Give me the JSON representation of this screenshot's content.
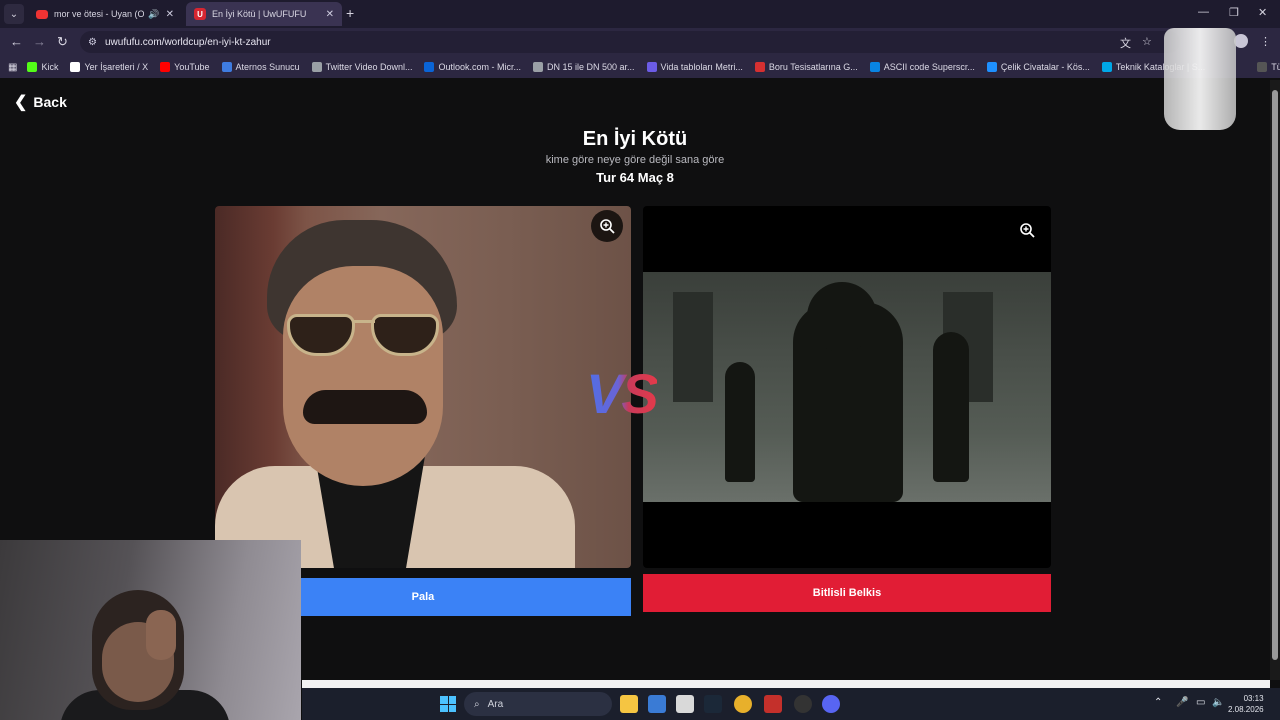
{
  "browser": {
    "tabs": [
      {
        "title": "mor ve ötesi - Uyan (Officia",
        "icon": "youtube-icon",
        "audio": true
      },
      {
        "title": "En İyi Kötü | UwUFUFU",
        "icon": "uwufufu-icon",
        "active": true
      }
    ],
    "url": "uwufufu.com/worldcup/en-iyi-kt-zahur",
    "bookmarks": [
      {
        "label": "Kick",
        "color": "#53fc18"
      },
      {
        "label": "Yer İşaretleri / X",
        "color": "#ffffff"
      },
      {
        "label": "YouTube",
        "color": "#ff0000"
      },
      {
        "label": "Aternos Sunucu",
        "color": "#3f7ce0"
      },
      {
        "label": "Twitter Video Downl...",
        "color": "#9aa0a6"
      },
      {
        "label": "Outlook.com - Micr...",
        "color": "#0a64d6"
      },
      {
        "label": "DN 15 ile DN 500 ar...",
        "color": "#9aa0a6"
      },
      {
        "label": "Vida tabloları Metri...",
        "color": "#6c5ce7"
      },
      {
        "label": "Boru Tesisatlarına G...",
        "color": "#d63031"
      },
      {
        "label": "ASCII code Superscr...",
        "color": "#0984e3"
      },
      {
        "label": "Çelik Civatalar - Kös...",
        "color": "#1e90ff"
      },
      {
        "label": "Teknik Kataloglar | S...",
        "color": "#00a8e8"
      }
    ],
    "all_bookmarks": "Tüm Yer İşaretleri"
  },
  "page": {
    "back_label": "Back",
    "title": "En İyi Kötü",
    "subtitle": "kime göre neye göre değil sana göre",
    "round": "Tur 64 Maç 8",
    "vs": "VS",
    "left_choice": "Pala",
    "right_choice": "Bitlisli Belkis"
  },
  "taskbar": {
    "search_placeholder": "Ara",
    "time": "03:13",
    "date": "2.08.2026"
  },
  "colors": {
    "left_button": "#3b82f6",
    "right_button": "#e11d35",
    "background": "#0f0f10"
  }
}
